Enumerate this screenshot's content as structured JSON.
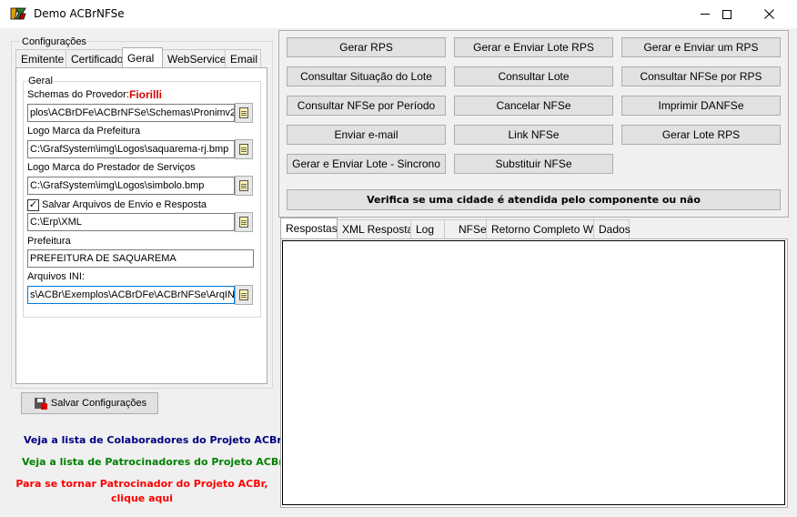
{
  "window": {
    "title": "Demo ACBrNFSe"
  },
  "config": {
    "group_label": "Configurações",
    "tabs": [
      {
        "label": "Emitente"
      },
      {
        "label": "Certificado"
      },
      {
        "label": "Geral"
      },
      {
        "label": "WebService"
      },
      {
        "label": "Email"
      }
    ],
    "active_tab": "Geral",
    "geral": {
      "group_label": "Geral",
      "schemas_label": "Schemas do Provedor:",
      "provider_name": "Fiorilli",
      "provider_color": "#d40000",
      "schemas_value": "plos\\ACBrDFe\\ACBrNFSe\\Schemas\\Pronimv2",
      "logo_prefeitura_label": "Logo Marca da Prefeitura",
      "logo_prefeitura_value": "C:\\GrafSystem\\img\\Logos\\saquarema-rj.bmp",
      "logo_prestador_label": "Logo Marca do Prestador de Serviços",
      "logo_prestador_value": "C:\\GrafSystem\\img\\Logos\\simbolo.bmp",
      "salvar_label": "Salvar Arquivos de Envio e Resposta",
      "salvar_checked": "✓",
      "salvar_path": "C:\\Erp\\XML",
      "prefeitura_label": "Prefeitura",
      "prefeitura_value": "PREFEITURA DE SAQUAREMA",
      "ini_label": "Arquivos INI:",
      "ini_value": "s\\ACBr\\Exemplos\\ACBrDFe\\ACBrNFSe\\ArqINI"
    },
    "save_button": "Salvar Configurações"
  },
  "links": {
    "colaboradores": "Veja a lista de Colaboradores do Projeto ACBr",
    "patrocinadores": "Veja a lista de Patrocinadores do Projeto ACBr",
    "patrocinador_line1": "Para se tornar Patrocinador do Projeto ACBr,",
    "patrocinador_line2": "clique aqui",
    "colors": {
      "colaboradores": "#000080",
      "patrocinadores": "#008000",
      "patrocinador": "#ff0000"
    }
  },
  "actions": {
    "gerar_rps": "Gerar RPS",
    "gerar_enviar_lote_rps": "Gerar e Enviar Lote RPS",
    "gerar_enviar_um_rps": "Gerar e Enviar um RPS",
    "consultar_situacao_lote": "Consultar Situação do Lote",
    "consultar_lote": "Consultar Lote",
    "consultar_nfse_por_rps": "Consultar NFSe por RPS",
    "consultar_nfse_por_periodo": "Consultar NFSe por Período",
    "cancelar_nfse": "Cancelar NFSe",
    "imprimir_danfse": "Imprimir DANFSe",
    "enviar_email": "Enviar e-mail",
    "link_nfse": "Link NFSe",
    "gerar_lote_rps": "Gerar Lote RPS",
    "gerar_enviar_lote_sincrono": "Gerar e Enviar Lote - Sincrono",
    "substituir_nfse": "Substituir NFSe",
    "verifica_cidade": "Verifica se uma cidade é atendida pelo componente ou não"
  },
  "response": {
    "tabs": [
      {
        "label": "Respostas"
      },
      {
        "label": "XML Resposta"
      },
      {
        "label": "Log"
      },
      {
        "label": "NFSe"
      },
      {
        "label": "Retorno Completo WS"
      },
      {
        "label": "Dados"
      }
    ],
    "active_tab": "Respostas"
  }
}
